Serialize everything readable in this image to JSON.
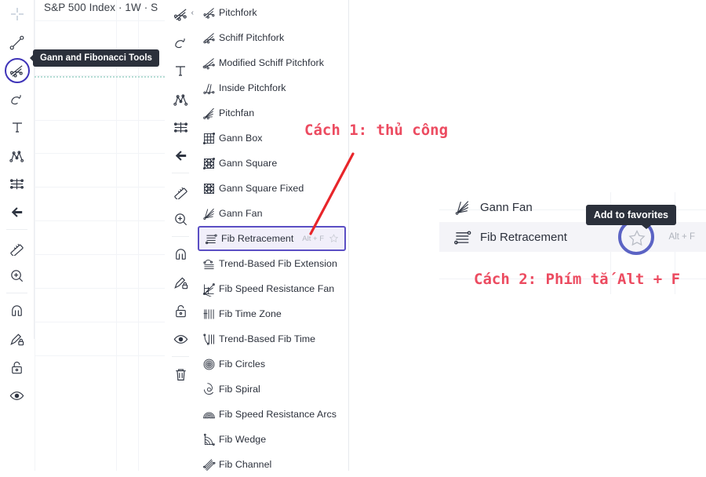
{
  "chart": {
    "title": "S&P 500 Index · 1W · S",
    "gridlines": {
      "horizontal": 7,
      "vertical": 3
    },
    "dashed_line_color": "#a9d8cd"
  },
  "tooltips": {
    "gann_tools": "Gann and Fibonacci Tools",
    "add_to_favorites": "Add to favorites"
  },
  "toolbar_primary": {
    "selected_index": 2,
    "items": [
      {
        "icon": "crosshair-icon",
        "name": "cursor-crosshair"
      },
      {
        "icon": "trend-line-icon",
        "name": "trend-line-tool"
      },
      {
        "icon": "gann-fib-icon",
        "name": "gann-and-fibonacci-tools"
      },
      {
        "icon": "brush-icon",
        "name": "brush-tool"
      },
      {
        "icon": "text-icon",
        "name": "text-tool"
      },
      {
        "icon": "patterns-icon",
        "name": "patterns-tool"
      },
      {
        "icon": "prediction-icon",
        "name": "prediction-measurement-tool"
      },
      {
        "icon": "arrow-left-icon",
        "name": "arrow-marker-tool"
      },
      {
        "icon": "ruler-icon",
        "name": "measure-tool"
      },
      {
        "icon": "zoom-in-icon",
        "name": "zoom-in-tool"
      },
      {
        "icon": "magnet-icon",
        "name": "magnet-mode"
      },
      {
        "icon": "pencil-lock-icon",
        "name": "stay-in-drawing-mode"
      },
      {
        "icon": "lock-icon",
        "name": "lock-all-drawings"
      },
      {
        "icon": "eye-icon",
        "name": "hide-all-drawings"
      }
    ]
  },
  "toolbar_secondary": {
    "collapse_chevron": "‹",
    "items": [
      {
        "icon": "gann-fib-icon",
        "name": "gann-and-fibonacci-tools"
      },
      {
        "icon": "brush-icon",
        "name": "brush-tool"
      },
      {
        "icon": "text-icon",
        "name": "text-tool"
      },
      {
        "icon": "patterns-icon",
        "name": "patterns-tool"
      },
      {
        "icon": "prediction-icon",
        "name": "prediction-measurement-tool"
      },
      {
        "icon": "arrow-left-icon",
        "name": "arrow-marker-tool"
      },
      {
        "icon": "ruler-icon",
        "name": "measure-tool"
      },
      {
        "icon": "zoom-in-icon",
        "name": "zoom-in-tool"
      },
      {
        "icon": "magnet-icon",
        "name": "magnet-mode"
      },
      {
        "icon": "pencil-lock-icon",
        "name": "stay-in-drawing-mode"
      },
      {
        "icon": "lock-icon",
        "name": "lock-all-drawings"
      },
      {
        "icon": "eye-icon",
        "name": "hide-all-drawings"
      },
      {
        "icon": "trash-icon",
        "name": "remove-drawings"
      }
    ]
  },
  "tools_menu": {
    "selected_label": "Fib Retracement",
    "selected_shortcut": "Alt + F",
    "items": [
      {
        "label": "Pitchfork",
        "icon": "pitchfork-icon"
      },
      {
        "label": "Schiff Pitchfork",
        "icon": "schiff-pitchfork-icon"
      },
      {
        "label": "Modified Schiff Pitchfork",
        "icon": "modified-schiff-pitchfork-icon"
      },
      {
        "label": "Inside Pitchfork",
        "icon": "inside-pitchfork-icon"
      },
      {
        "label": "Pitchfan",
        "icon": "pitchfan-icon"
      },
      {
        "label": "Gann Box",
        "icon": "gann-box-icon"
      },
      {
        "label": "Gann Square",
        "icon": "gann-square-icon"
      },
      {
        "label": "Gann Square Fixed",
        "icon": "gann-square-fixed-icon"
      },
      {
        "label": "Gann Fan",
        "icon": "gann-fan-icon"
      },
      {
        "label": "Fib Retracement",
        "icon": "fib-retracement-icon",
        "shortcut": "Alt + F",
        "selected": true
      },
      {
        "label": "Trend-Based Fib Extension",
        "icon": "trend-based-fib-extension-icon"
      },
      {
        "label": "Fib Speed Resistance Fan",
        "icon": "fib-speed-resistance-fan-icon"
      },
      {
        "label": "Fib Time Zone",
        "icon": "fib-time-zone-icon"
      },
      {
        "label": "Trend-Based Fib Time",
        "icon": "trend-based-fib-time-icon"
      },
      {
        "label": "Fib Circles",
        "icon": "fib-circles-icon"
      },
      {
        "label": "Fib Spiral",
        "icon": "fib-spiral-icon"
      },
      {
        "label": "Fib Speed Resistance Arcs",
        "icon": "fib-speed-resistance-arcs-icon"
      },
      {
        "label": "Fib Wedge",
        "icon": "fib-wedge-icon"
      },
      {
        "label": "Fib Channel",
        "icon": "fib-channel-icon"
      }
    ]
  },
  "favorites_panel": {
    "rows": [
      {
        "label": "Gann Fan",
        "icon": "gann-fan-icon",
        "shortcut": "",
        "active": false
      },
      {
        "label": "Fib Retracement",
        "icon": "fib-retracement-icon",
        "shortcut": "Alt + F",
        "active": true
      }
    ]
  },
  "annotations": {
    "method_1": "Cách 1: thủ công",
    "method_2": "Cách 2: Phím tắ Alt + F",
    "color": "#ec4b60"
  },
  "colors": {
    "highlight_border": "#5b4fc4",
    "highlight_fill": "#f1effa",
    "selection_ring": "#3f34b8",
    "tooltip_bg": "#2b303b",
    "annotation_red": "#ec4b60"
  }
}
